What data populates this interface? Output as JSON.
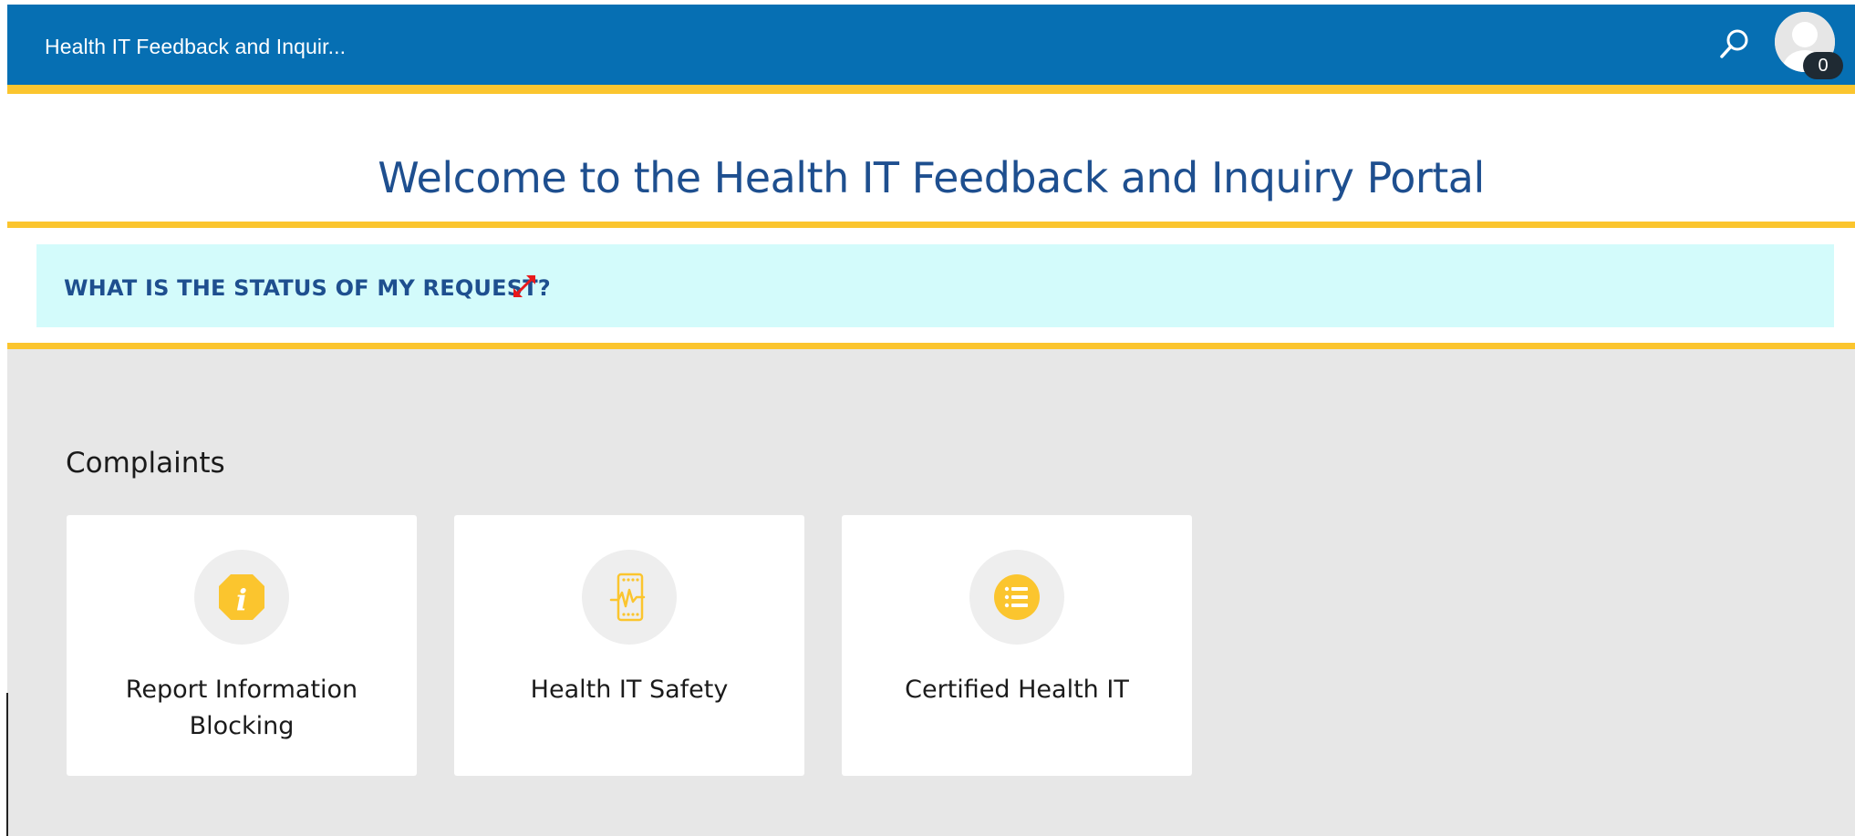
{
  "header": {
    "app_title": "Health IT Feedback and Inquir...",
    "notification_count": "0",
    "search_icon": "search-icon",
    "avatar_icon": "user-avatar-icon",
    "colors": {
      "bar": "#066fb3",
      "accent_stripe": "#fbc52e"
    }
  },
  "hero": {
    "title": "Welcome to the Health IT Feedback and Inquiry Portal"
  },
  "status_panel": {
    "label": "WHAT IS THE STATUS OF MY REQUEST?",
    "icon": "expand-arrows-icon",
    "background": "#d3fbfb"
  },
  "complaints": {
    "heading": "Complaints",
    "cards": [
      {
        "label": "Report Information Blocking",
        "icon": "info-octagon-icon"
      },
      {
        "label": "Health IT Safety",
        "icon": "mobile-heartbeat-icon"
      },
      {
        "label": "Certified Health IT",
        "icon": "list-circle-icon"
      }
    ]
  }
}
